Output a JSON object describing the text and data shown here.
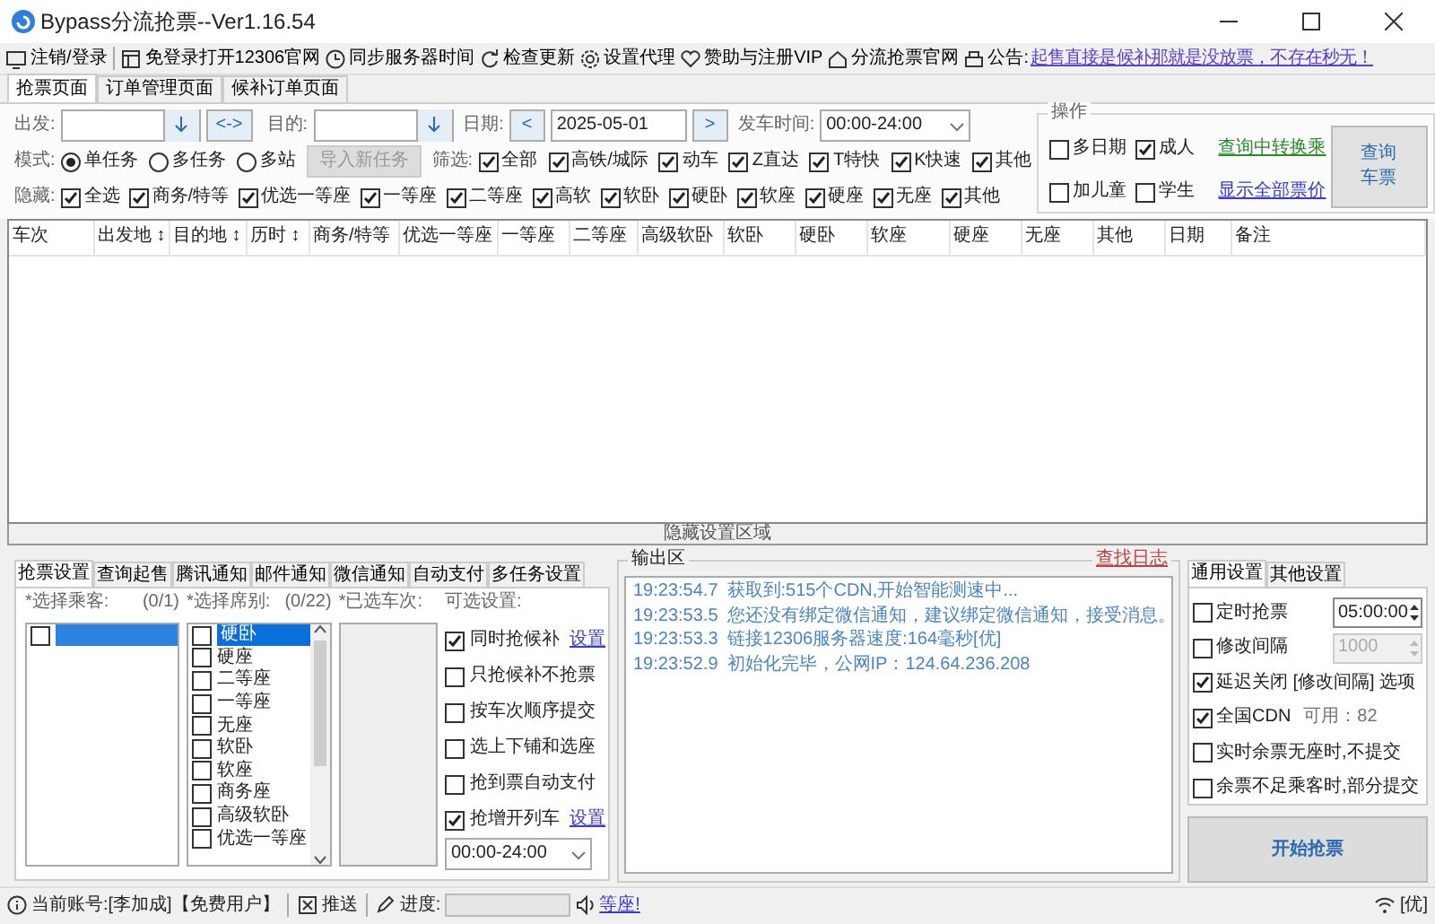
{
  "window": {
    "title": "Bypass分流抢票--Ver1.16.54"
  },
  "toolbar": [
    {
      "label": "注销/登录"
    },
    {
      "label": "免登录打开12306官网"
    },
    {
      "label": "同步服务器时间"
    },
    {
      "label": "检查更新"
    },
    {
      "label": "设置代理"
    },
    {
      "label": "赞助与注册VIP"
    },
    {
      "label": "分流抢票官网"
    },
    {
      "label": "公告:"
    }
  ],
  "notice": "起售直接是候补那就是没放票，不存在秒无！",
  "page_tabs": [
    {
      "label": "抢票页面",
      "selected": true
    },
    {
      "label": "订单管理页面",
      "selected": false
    },
    {
      "label": "候补订单页面",
      "selected": false
    }
  ],
  "query": {
    "from_label": "出发:",
    "swap": "<->",
    "to_label": "目的:",
    "date_label": "日期:",
    "prev": "<",
    "date": "2025-05-01",
    "next": ">",
    "time_label": "发车时间:",
    "time": "00:00-24:00"
  },
  "mode": {
    "label": "模式:",
    "options": [
      {
        "label": "单任务",
        "selected": true
      },
      {
        "label": "多任务",
        "selected": false
      },
      {
        "label": "多站",
        "selected": false
      }
    ],
    "import_button": {
      "label": "导入新任务",
      "disabled": true
    }
  },
  "filter": {
    "label": "筛选:",
    "options": [
      {
        "label": "全部",
        "checked": true
      },
      {
        "label": "高铁/城际",
        "checked": true
      },
      {
        "label": "动车",
        "checked": true
      },
      {
        "label": "Z直达",
        "checked": true
      },
      {
        "label": "T特快",
        "checked": true
      },
      {
        "label": "K快速",
        "checked": true
      },
      {
        "label": "其他",
        "checked": true
      }
    ]
  },
  "hide": {
    "label": "隐藏:",
    "options": [
      {
        "label": "全选",
        "checked": true
      },
      {
        "label": "商务/特等",
        "checked": true
      },
      {
        "label": "优选一等座",
        "checked": true
      },
      {
        "label": "一等座",
        "checked": true
      },
      {
        "label": "二等座",
        "checked": true
      },
      {
        "label": "高软",
        "checked": true
      },
      {
        "label": "软卧",
        "checked": true
      },
      {
        "label": "硬卧",
        "checked": true
      },
      {
        "label": "软座",
        "checked": true
      },
      {
        "label": "硬座",
        "checked": true
      },
      {
        "label": "无座",
        "checked": true
      },
      {
        "label": "其他",
        "checked": true
      }
    ]
  },
  "operations": {
    "title": "操作",
    "options": [
      {
        "label": "多日期",
        "checked": false
      },
      {
        "label": "成人",
        "checked": true
      },
      {
        "label": "加儿童",
        "checked": false
      },
      {
        "label": "学生",
        "checked": false
      }
    ],
    "links": [
      {
        "label": "查询中转换乘",
        "kind": "green"
      },
      {
        "label": "显示全部票价",
        "kind": "blue"
      }
    ],
    "button": [
      "查询",
      "车票"
    ]
  },
  "table": {
    "columns": [
      "车次",
      "出发地 ↕",
      "目的地 ↕",
      "历时 ↕",
      "商务/特等",
      "优选一等座",
      "一等座",
      "二等座",
      "高级软卧",
      "软卧",
      "硬卧",
      "软座",
      "硬座",
      "无座",
      "其他",
      "日期",
      "备注"
    ]
  },
  "splitter": "隐藏设置区域",
  "settings_tabs": [
    {
      "label": "抢票设置",
      "selected": true
    },
    {
      "label": "查询起售",
      "selected": false
    },
    {
      "label": "腾讯通知",
      "selected": false
    },
    {
      "label": "邮件通知",
      "selected": false
    },
    {
      "label": "微信通知",
      "selected": false
    },
    {
      "label": "自动支付",
      "selected": false
    },
    {
      "label": "多任务设置",
      "selected": false
    }
  ],
  "passengers": {
    "label": "*选择乘客:",
    "count": "(0/1)",
    "items": [
      {
        "checked": false,
        "selected": true
      }
    ]
  },
  "seats": {
    "label": "*选择席别:",
    "count": "(0/22)",
    "items": [
      {
        "label": "硬卧",
        "checked": false,
        "selected": true
      },
      {
        "label": "硬座",
        "checked": false,
        "selected": false
      },
      {
        "label": "二等座",
        "checked": false,
        "selected": false
      },
      {
        "label": "一等座",
        "checked": false,
        "selected": false
      },
      {
        "label": "无座",
        "checked": false,
        "selected": false
      },
      {
        "label": "软卧",
        "checked": false,
        "selected": false
      },
      {
        "label": "软座",
        "checked": false,
        "selected": false
      },
      {
        "label": "商务座",
        "checked": false,
        "selected": false
      },
      {
        "label": "高级软卧",
        "checked": false,
        "selected": false
      },
      {
        "label": "优选一等座",
        "checked": false,
        "selected": false
      }
    ]
  },
  "trains": {
    "label": "*已选车次:"
  },
  "optional": {
    "label": "可选设置:",
    "items": [
      {
        "label": "同时抢候补",
        "checked": true,
        "link": "设置"
      },
      {
        "label": "只抢候补不抢票",
        "checked": false
      },
      {
        "label": "按车次顺序提交",
        "checked": false
      },
      {
        "label": "选上下铺和选座",
        "checked": false
      },
      {
        "label": "抢到票自动支付",
        "checked": false
      },
      {
        "label": "抢增开列车",
        "checked": true,
        "link": "设置"
      }
    ],
    "time": "00:00-24:00"
  },
  "output": {
    "title": "输出区",
    "link": "查找日志",
    "lines": [
      {
        "time": "19:23:54.7",
        "text": "获取到:515个CDN,开始智能测速中..."
      },
      {
        "time": "19:23:53.5",
        "text": "您还没有绑定微信通知，建议绑定微信通知，接受消息。"
      },
      {
        "time": "19:23:53.3",
        "text": "链接12306服务器速度:164毫秒[优]"
      },
      {
        "time": "19:23:52.9",
        "text": "初始化完毕，公网IP：124.64.236.208"
      }
    ]
  },
  "general_tabs": [
    {
      "label": "通用设置",
      "selected": true
    },
    {
      "label": "其他设置",
      "selected": false
    }
  ],
  "general": [
    {
      "kind": "spin",
      "label": "定时抢票",
      "checked": false,
      "value": "05:00:00",
      "disabled": false
    },
    {
      "kind": "spin",
      "label": "修改间隔",
      "checked": false,
      "value": "1000",
      "disabled": true
    },
    {
      "kind": "plain",
      "label": "延迟关闭 [修改间隔] 选项",
      "checked": true
    },
    {
      "kind": "note",
      "label": "全国CDN",
      "checked": true,
      "note": "可用：82"
    },
    {
      "kind": "plain",
      "label": "实时余票无座时,不提交",
      "checked": false
    },
    {
      "kind": "plain",
      "label": "余票不足乘客时,部分提交",
      "checked": false
    }
  ],
  "start_button": "开始抢票",
  "status_bar": {
    "account": "当前账号:[李加成]【免费用户】",
    "push": "推送",
    "progress_label": "进度:",
    "progress": {
      "level": 0
    },
    "sound": "等座!",
    "quality": "[优]"
  }
}
